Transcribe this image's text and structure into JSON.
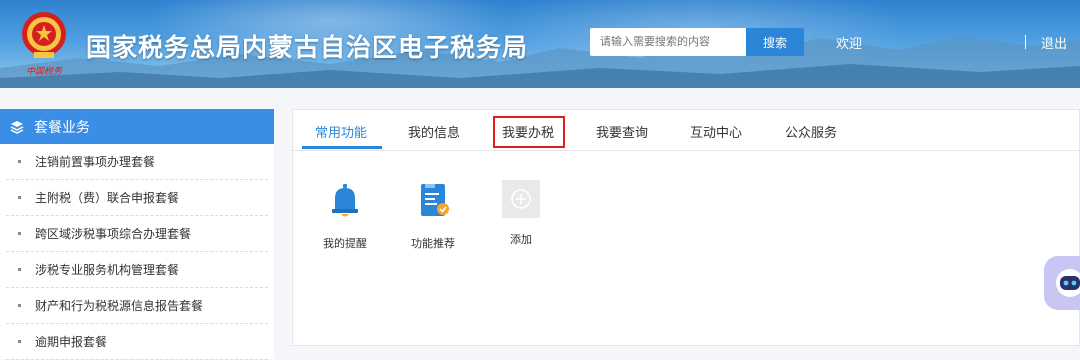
{
  "header": {
    "title": "国家税务总局内蒙古自治区电子税务局",
    "search_placeholder": "请输入需要搜索的内容",
    "search_button": "搜索",
    "welcome": "欢迎",
    "logout": "退出",
    "emblem_text": "中国税务"
  },
  "sidebar": {
    "header": "套餐业务",
    "items": [
      {
        "label": "注销前置事项办理套餐"
      },
      {
        "label": "主附税（费）联合申报套餐"
      },
      {
        "label": "跨区域涉税事项综合办理套餐"
      },
      {
        "label": "涉税专业服务机构管理套餐"
      },
      {
        "label": "财产和行为税税源信息报告套餐"
      },
      {
        "label": "逾期申报套餐"
      }
    ]
  },
  "tabs": [
    {
      "label": "常用功能",
      "active": true
    },
    {
      "label": "我的信息"
    },
    {
      "label": "我要办税",
      "highlighted": true
    },
    {
      "label": "我要查询"
    },
    {
      "label": "互动中心"
    },
    {
      "label": "公众服务"
    }
  ],
  "apps": [
    {
      "label": "我的提醒",
      "icon": "bell-icon"
    },
    {
      "label": "功能推荐",
      "icon": "document-icon"
    },
    {
      "label": "添加",
      "icon": "add-icon"
    }
  ],
  "colors": {
    "accent": "#2b86d9",
    "sidebar_header": "#3a8ee6",
    "highlight_border": "#e01c1c",
    "robot_bg": "#c9c6f4"
  }
}
